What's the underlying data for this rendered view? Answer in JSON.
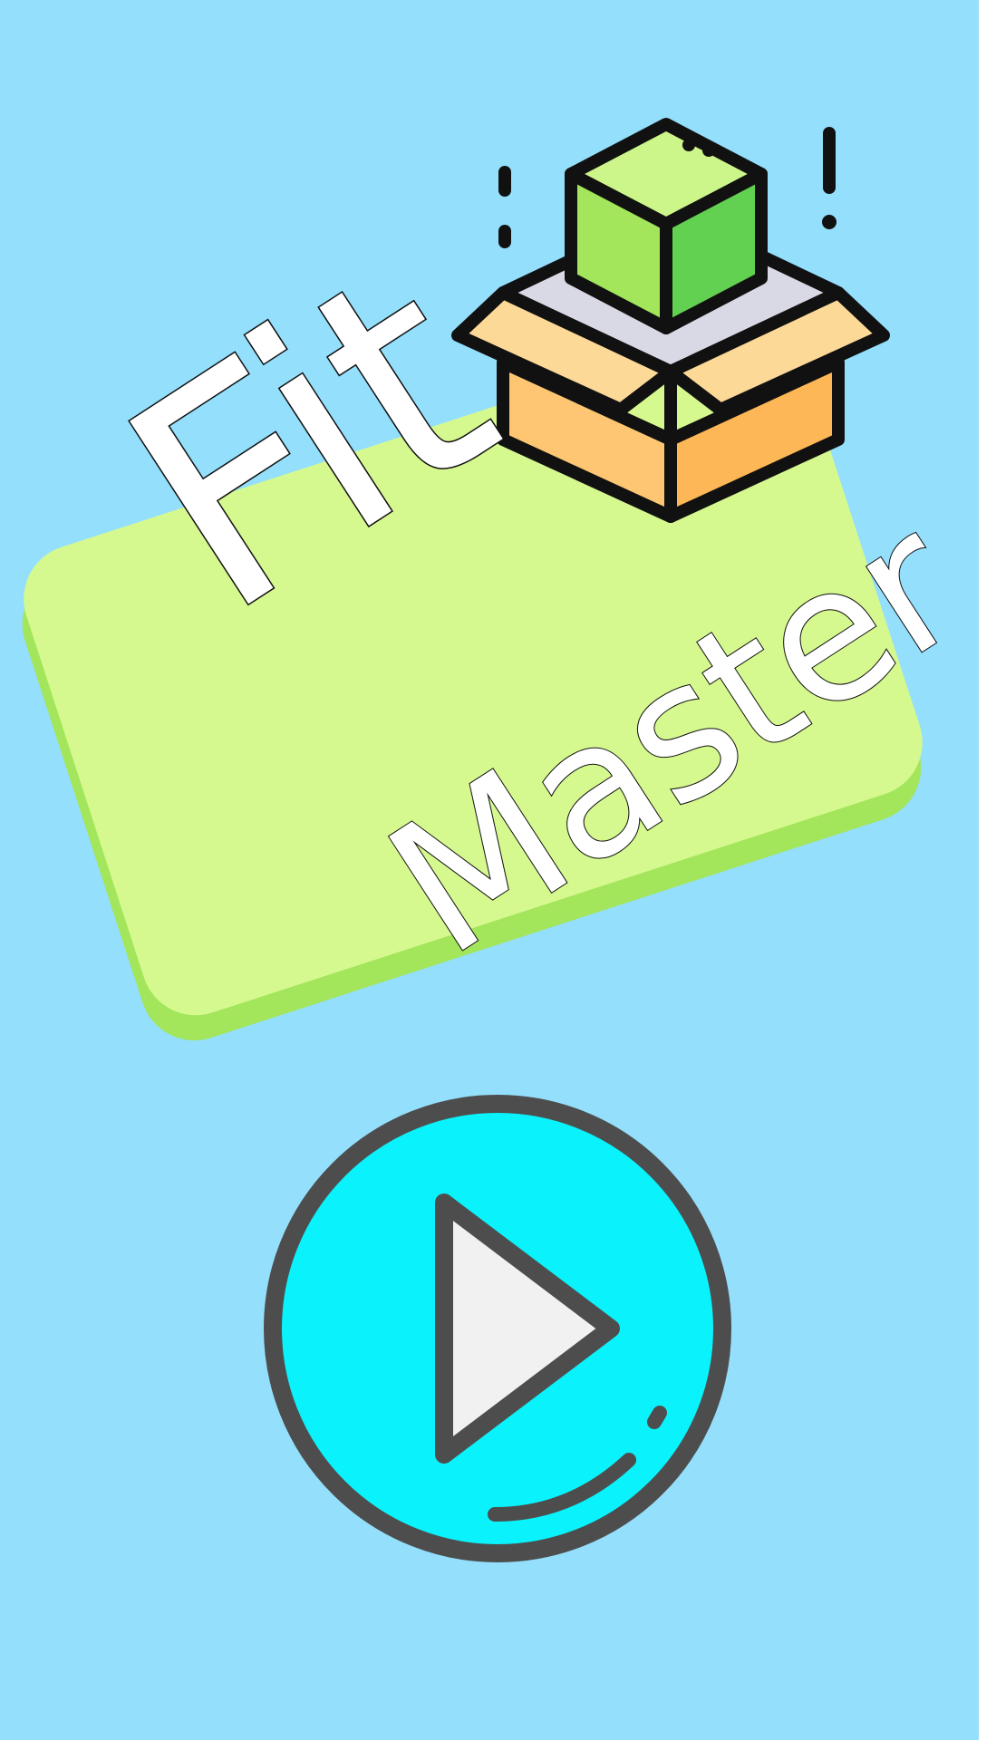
{
  "app": {
    "title_main": "Fit",
    "title_sub": "Master"
  },
  "icons": {
    "logo_icon": "box-with-cube-icon",
    "play_icon": "play-icon"
  },
  "colors": {
    "background": "#94dffc",
    "gutter": "#ffffff",
    "panel_face": "#d5f98f",
    "panel_shadow": "#a3e55b",
    "play_fill": "#0af2fc",
    "play_outline": "#4d4d4d",
    "play_triangle": "#f1f1f1"
  }
}
